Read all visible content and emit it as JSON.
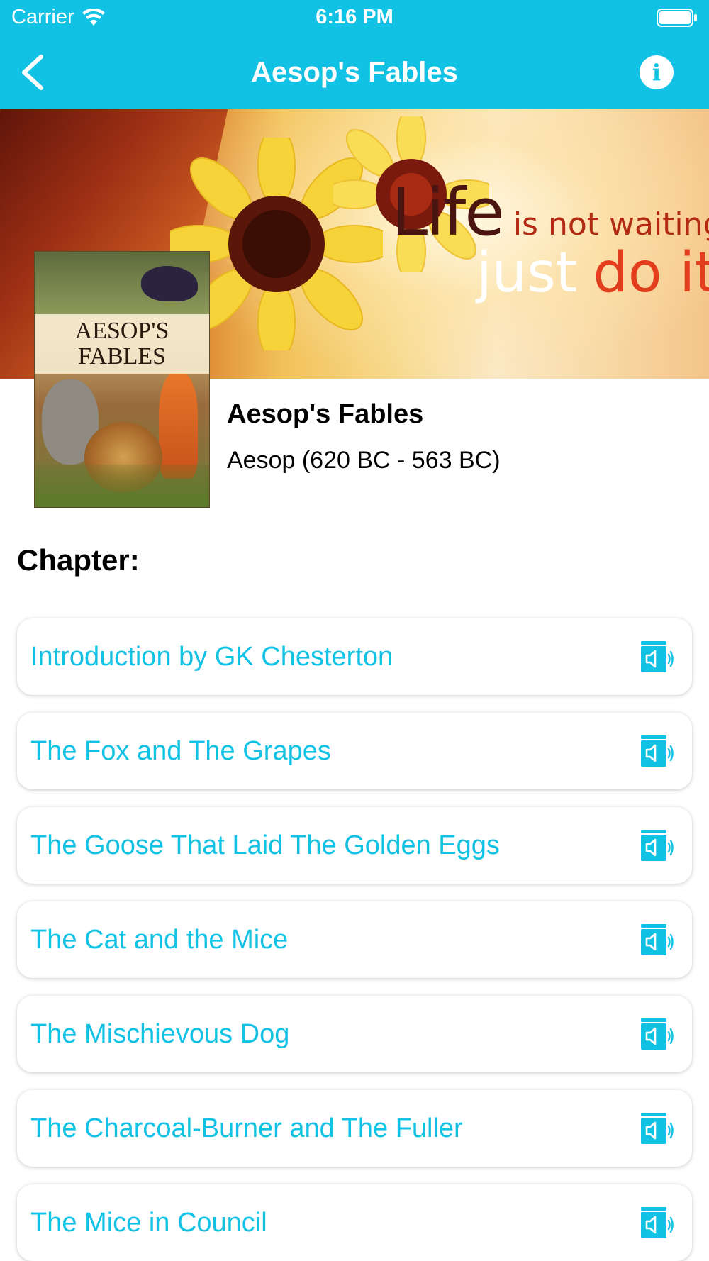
{
  "status_bar": {
    "carrier": "Carrier",
    "time": "6:16 PM"
  },
  "nav": {
    "title": "Aesop's Fables",
    "back_icon": "chevron-left-icon",
    "info_icon": "info-icon",
    "info_glyph": "i"
  },
  "banner": {
    "line1_big": "Life",
    "line1_small": "is not waiting",
    "line2_a": "just",
    "line2_b": "do it!"
  },
  "cover": {
    "title": "AESOP'S FABLES",
    "title_line1": "AESOP'S",
    "title_line2": "FABLES"
  },
  "book": {
    "title": "Aesop's Fables",
    "author": "Aesop (620 BC - 563 BC)"
  },
  "chapter_heading": "Chapter:",
  "chapters": [
    {
      "label": "Introduction by GK Chesterton",
      "icon": "audio-book-icon"
    },
    {
      "label": "The Fox and The Grapes",
      "icon": "audio-book-icon"
    },
    {
      "label": "The Goose That Laid The Golden Eggs",
      "icon": "audio-book-icon"
    },
    {
      "label": "The Cat and the Mice",
      "icon": "audio-book-icon"
    },
    {
      "label": "The Mischievous Dog",
      "icon": "audio-book-icon"
    },
    {
      "label": "The Charcoal-Burner and The Fuller",
      "icon": "audio-book-icon"
    },
    {
      "label": "The Mice in Council",
      "icon": "audio-book-icon"
    }
  ],
  "colors": {
    "accent": "#12c2e5",
    "text": "#000000",
    "background": "#ffffff"
  }
}
